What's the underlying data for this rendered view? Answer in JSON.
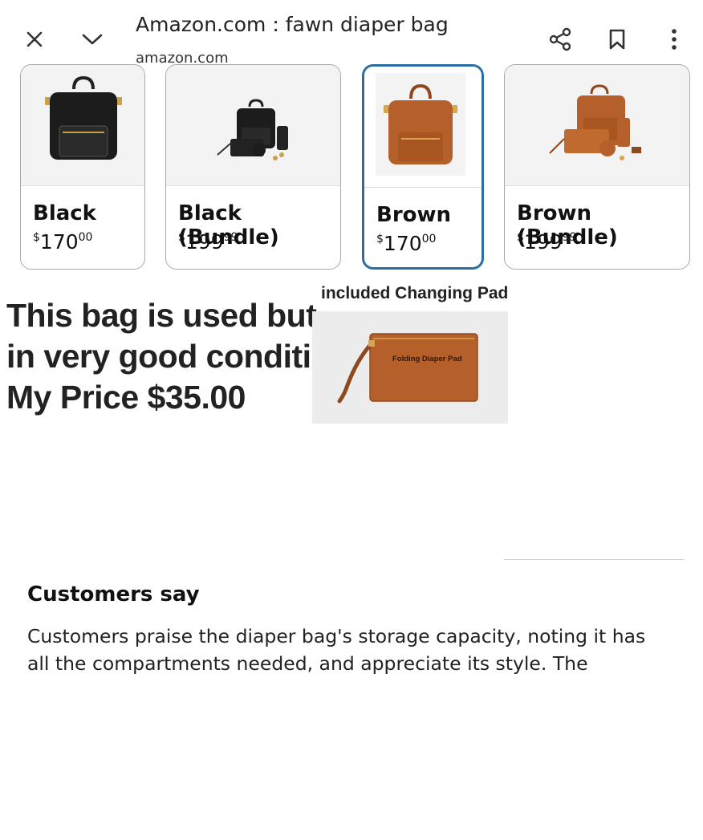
{
  "topbar": {
    "title": "Amazon.com : fawn diaper bag",
    "url": "amazon.com",
    "close_icon": "close-icon",
    "chevron_icon": "chevron-down-icon",
    "share_icon": "share-icon",
    "bookmark_icon": "bookmark-icon",
    "menu_icon": "more-vertical-icon"
  },
  "variants": [
    {
      "label": "Black",
      "currency": "$",
      "whole": "170",
      "fraction": "00",
      "color": "black",
      "selected": false
    },
    {
      "label": "Black (Bundle)",
      "currency": "$",
      "whole": "199",
      "fraction": "99",
      "color": "black",
      "selected": false
    },
    {
      "label": "Brown",
      "currency": "$",
      "whole": "170",
      "fraction": "00",
      "color": "brown",
      "selected": true
    },
    {
      "label": "Brown (Bundle)",
      "currency": "$",
      "whole": "199",
      "fraction": "99",
      "color": "brown",
      "selected": false
    }
  ],
  "overlay": {
    "line1": "This bag is used but",
    "line2": "in very good condition",
    "line3": "My Price $35.00",
    "pad_caption": "included Changing Pad",
    "pad_label": "Folding Diaper Pad"
  },
  "customers": {
    "title": "Customers say",
    "body": "Customers praise the diaper bag's storage capacity, noting it has all the compartments needed, and appreciate its style. The"
  },
  "colors": {
    "accent_selected": "#2a6ea7",
    "leather_brown": "#b5602a",
    "leather_black": "#1c1c1c"
  }
}
